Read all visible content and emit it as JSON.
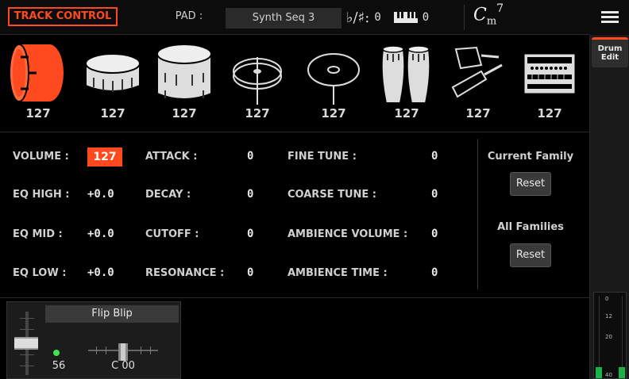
{
  "header": {
    "title": "TRACK CONTROL",
    "pad_label": "PAD :",
    "pad_value": "Synth Seq 3",
    "transpose_symbol": "♭/♯:",
    "transpose_value": "0",
    "keyboard_octave_value": "0",
    "chord_root": "C",
    "chord_quality": "m",
    "chord_extension": "7",
    "menu_icon": "hamburger-menu-icon"
  },
  "drums": [
    {
      "icon": "kick-drum-icon",
      "value": "127",
      "selected": true
    },
    {
      "icon": "snare-drum-icon",
      "value": "127"
    },
    {
      "icon": "tom-drum-icon",
      "value": "127"
    },
    {
      "icon": "hihat-cymbal-icon",
      "value": "127"
    },
    {
      "icon": "ride-cymbal-icon",
      "value": "127"
    },
    {
      "icon": "conga-icon",
      "value": "127"
    },
    {
      "icon": "shaker-icon",
      "value": "127"
    },
    {
      "icon": "drum-machine-icon",
      "value": "127"
    }
  ],
  "params": {
    "volume": {
      "label": "VOLUME :",
      "value": "127"
    },
    "eq_high": {
      "label": "EQ HIGH :",
      "value": "+0.0"
    },
    "eq_mid": {
      "label": "EQ MID :",
      "value": "+0.0"
    },
    "eq_low": {
      "label": "EQ LOW :",
      "value": "+0.0"
    },
    "attack": {
      "label": "ATTACK :",
      "value": "0"
    },
    "decay": {
      "label": "DECAY :",
      "value": "0"
    },
    "cutoff": {
      "label": "CUTOFF :",
      "value": "0"
    },
    "resonance": {
      "label": "RESONANCE :",
      "value": "0"
    },
    "fine_tune": {
      "label": "FINE TUNE :",
      "value": "0"
    },
    "coarse_tune": {
      "label": "COARSE TUNE :",
      "value": "0"
    },
    "ambience_volume": {
      "label": "AMBIENCE VOLUME :",
      "value": "0"
    },
    "ambience_time": {
      "label": "AMBIENCE TIME :",
      "value": "0"
    }
  },
  "families": {
    "current_label": "Current Family",
    "current_reset": "Reset",
    "all_label": "All Families",
    "all_reset": "Reset"
  },
  "sidebar": {
    "drum_edit_line1": "Drum",
    "drum_edit_line2": "Edit",
    "meter_scale": [
      "0",
      "12",
      "20",
      "40"
    ]
  },
  "track_strip": {
    "name": "Flip Blip",
    "volume": "56",
    "pan": "C 00",
    "led_color": "#3fe44f"
  },
  "colors": {
    "accent": "#ff4a1f",
    "meter_green": "#19b34a"
  }
}
